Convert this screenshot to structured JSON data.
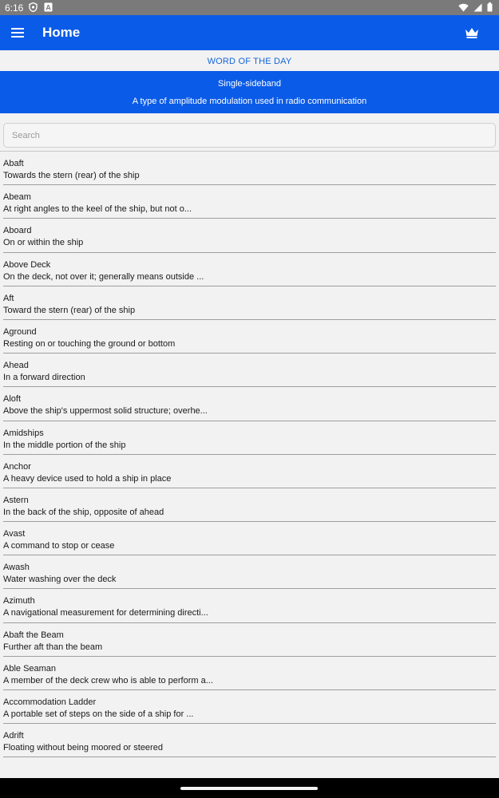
{
  "status_bar": {
    "time": "6:16",
    "left_icons": [
      "shield-icon",
      "a-badge-icon"
    ],
    "right_icons": [
      "wifi-icon",
      "signal-icon",
      "battery-icon"
    ]
  },
  "app_bar": {
    "title": "Home",
    "menu_icon": "hamburger-menu-icon",
    "premium_icon": "crown-icon",
    "color": "#0a5be8"
  },
  "word_of_the_day": {
    "header": "WORD OF THE DAY",
    "word": "Single-sideband",
    "definition": "A type of amplitude modulation used in radio communication"
  },
  "search": {
    "placeholder": "Search",
    "value": ""
  },
  "terms": [
    {
      "term": "Abaft",
      "definition": "Towards the stern (rear) of the ship"
    },
    {
      "term": "Abeam",
      "definition": "At right angles to the keel of the ship, but not o..."
    },
    {
      "term": "Aboard",
      "definition": "On or within the ship"
    },
    {
      "term": "Above Deck",
      "definition": "On the deck, not over it; generally means outside ..."
    },
    {
      "term": "Aft",
      "definition": "Toward the stern (rear) of the ship"
    },
    {
      "term": "Aground",
      "definition": "Resting on or touching the ground or bottom"
    },
    {
      "term": "Ahead",
      "definition": "In a forward direction"
    },
    {
      "term": "Aloft",
      "definition": "Above the ship's uppermost solid structure; overhe..."
    },
    {
      "term": "Amidships",
      "definition": "In the middle portion of the ship"
    },
    {
      "term": "Anchor",
      "definition": "A heavy device used to hold a ship in place"
    },
    {
      "term": "Astern",
      "definition": "In the back of the ship, opposite of ahead"
    },
    {
      "term": "Avast",
      "definition": "A command to stop or cease"
    },
    {
      "term": "Awash",
      "definition": "Water washing over the deck"
    },
    {
      "term": "Azimuth",
      "definition": "A navigational measurement for determining directi..."
    },
    {
      "term": "Abaft the Beam",
      "definition": "Further aft than the beam"
    },
    {
      "term": "Able Seaman",
      "definition": "A member of the deck crew who is able to perform a..."
    },
    {
      "term": "Accommodation Ladder",
      "definition": "A portable set of steps on the side of a ship for ..."
    },
    {
      "term": "Adrift",
      "definition": "Floating without being moored or steered"
    }
  ]
}
